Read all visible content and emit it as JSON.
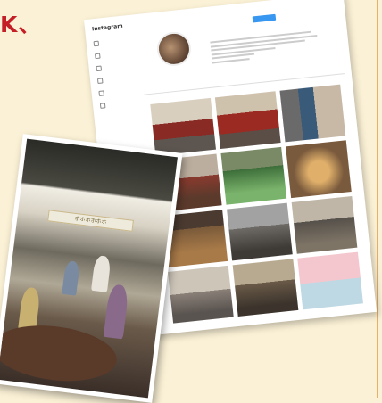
{
  "heading": "K、",
  "instagram": {
    "brand": "Instagram",
    "nav_items": [
      "",
      "",
      "",
      "",
      "",
      ""
    ],
    "username": "",
    "follow_label": "",
    "stats": "",
    "tab_label": ""
  },
  "photo": {
    "sign_text": "ホホホホホホ"
  }
}
